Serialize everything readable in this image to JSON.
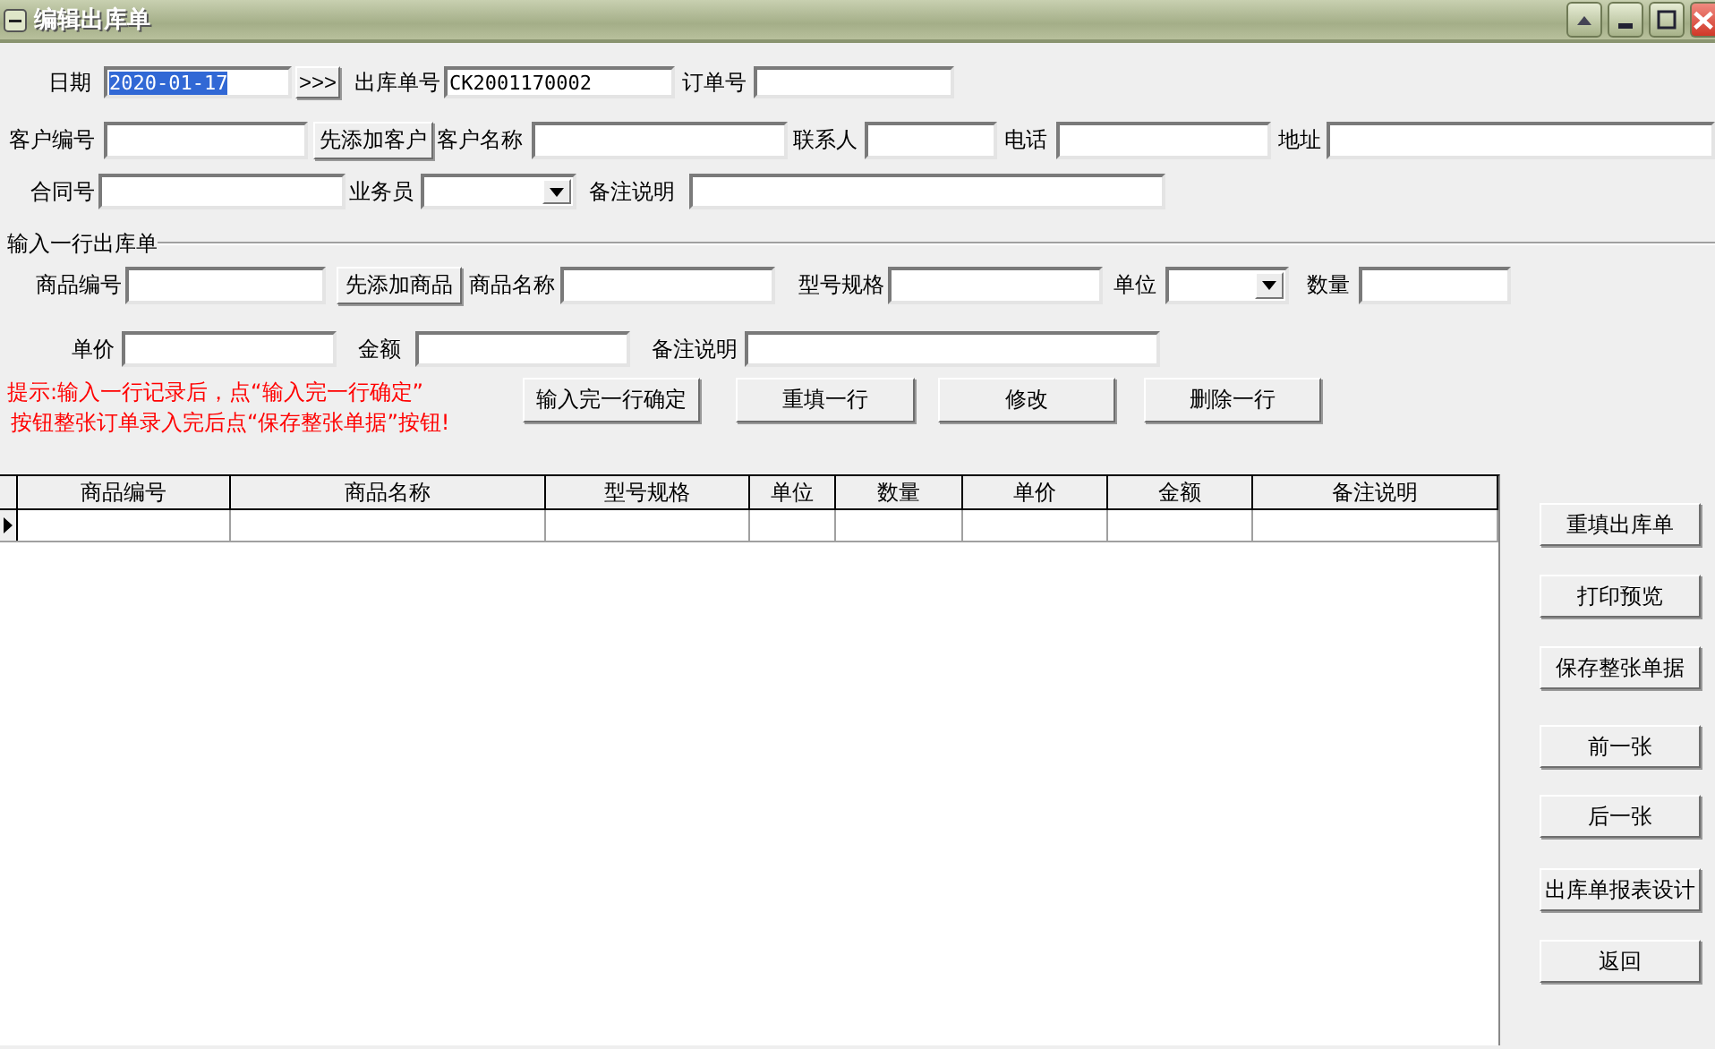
{
  "window": {
    "title": "编辑出库单"
  },
  "header_rows": [
    [
      {
        "kind": "label",
        "text": "日期"
      },
      {
        "kind": "field",
        "value": "2020-01-17",
        "selected": true
      },
      {
        "kind": "button",
        "text": ">>>"
      },
      {
        "kind": "label",
        "text": "出库单号"
      },
      {
        "kind": "field",
        "value": "CK2001170002",
        "selected": false
      },
      {
        "kind": "label",
        "text": "订单号"
      },
      {
        "kind": "field"
      }
    ],
    [
      {
        "kind": "label",
        "text": "客户编号"
      },
      {
        "kind": "field"
      },
      {
        "kind": "button",
        "text": "先添加客户"
      },
      {
        "kind": "label",
        "text": "客户名称"
      },
      {
        "kind": "field"
      },
      {
        "kind": "label",
        "text": "联系人"
      },
      {
        "kind": "field"
      },
      {
        "kind": "label",
        "text": "电话"
      },
      {
        "kind": "field"
      },
      {
        "kind": "label",
        "text": "地址"
      },
      {
        "kind": "field"
      }
    ],
    [
      {
        "kind": "label",
        "text": "合同号"
      },
      {
        "kind": "field"
      },
      {
        "kind": "label",
        "text": "业务员"
      },
      {
        "kind": "combo"
      },
      {
        "kind": "label",
        "text": "备注说明"
      },
      {
        "kind": "field"
      }
    ]
  ],
  "line_entry": {
    "title": "输入一行出库单",
    "rows": [
      [
        {
          "kind": "label",
          "text": "商品编号"
        },
        {
          "kind": "field"
        },
        {
          "kind": "button",
          "text": "先添加商品"
        },
        {
          "kind": "label",
          "text": "商品名称"
        },
        {
          "kind": "field"
        },
        {
          "kind": "label",
          "text": "型号规格"
        },
        {
          "kind": "field"
        },
        {
          "kind": "label",
          "text": "单位"
        },
        {
          "kind": "combo"
        },
        {
          "kind": "label",
          "text": "数量"
        },
        {
          "kind": "field"
        }
      ],
      [
        {
          "kind": "label",
          "text": "单价"
        },
        {
          "kind": "field"
        },
        {
          "kind": "label",
          "text": "金额"
        },
        {
          "kind": "field"
        },
        {
          "kind": "label",
          "text": "备注说明"
        },
        {
          "kind": "field"
        }
      ]
    ],
    "hint": [
      "提示:输入一行记录后，点“输入完一行确定”",
      "按钮整张订单录入完后点“保存整张单据”按钮!"
    ],
    "buttons": [
      "输入完一行确定",
      "重填一行",
      "修改",
      "删除一行"
    ]
  },
  "table": {
    "columns": [
      "商品编号",
      "商品名称",
      "型号规格",
      "单位",
      "数量",
      "单价",
      "金额",
      "备注说明"
    ],
    "rows": [
      {
        "current": true
      }
    ]
  },
  "side_buttons": [
    "重填出库单",
    "打印预览",
    "保存整张单据",
    "前一张",
    "后一张",
    "出库单报表设计",
    "返回"
  ]
}
